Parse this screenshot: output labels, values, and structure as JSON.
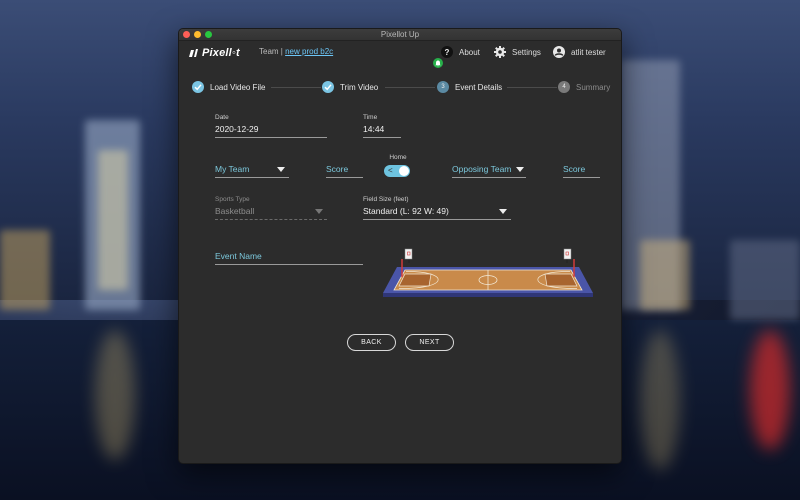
{
  "window": {
    "title": "Pixellot Up"
  },
  "header": {
    "logo_text": "Pixell◦t",
    "team_label": "Team |",
    "team_link": "new prod b2c",
    "about_label": "About",
    "settings_label": "Settings",
    "user_label": "atlit tester"
  },
  "steps": [
    {
      "label": "Load Video File",
      "state": "done"
    },
    {
      "label": "Trim Video",
      "state": "done"
    },
    {
      "number": "3",
      "label": "Event Details",
      "state": "active"
    },
    {
      "number": "4",
      "label": "Summary",
      "state": "pending"
    }
  ],
  "form": {
    "date": {
      "label": "Date",
      "value": "2020-12-29"
    },
    "time": {
      "label": "Time",
      "value": "14:44"
    },
    "my_team": {
      "value": "My Team"
    },
    "my_score": {
      "placeholder": "Score"
    },
    "home": {
      "label": "Home",
      "on": true
    },
    "opposing_team": {
      "value": "Opposing Team"
    },
    "opposing_score": {
      "placeholder": "Score"
    },
    "sports_type": {
      "label": "Sports Type",
      "value": "Basketball",
      "disabled": true
    },
    "field_size": {
      "label": "Field Size (feet)",
      "value": "Standard (L: 92 W: 49)"
    },
    "event_name": {
      "placeholder": "Event Name"
    }
  },
  "buttons": {
    "back": "BACK",
    "next": "NEXT"
  },
  "colors": {
    "accent": "#7bc5e3",
    "link": "#6cc6f7",
    "window_bg": "#2c2c2c",
    "court_wood": "#c98a4a",
    "court_border": "#4a55a8"
  }
}
